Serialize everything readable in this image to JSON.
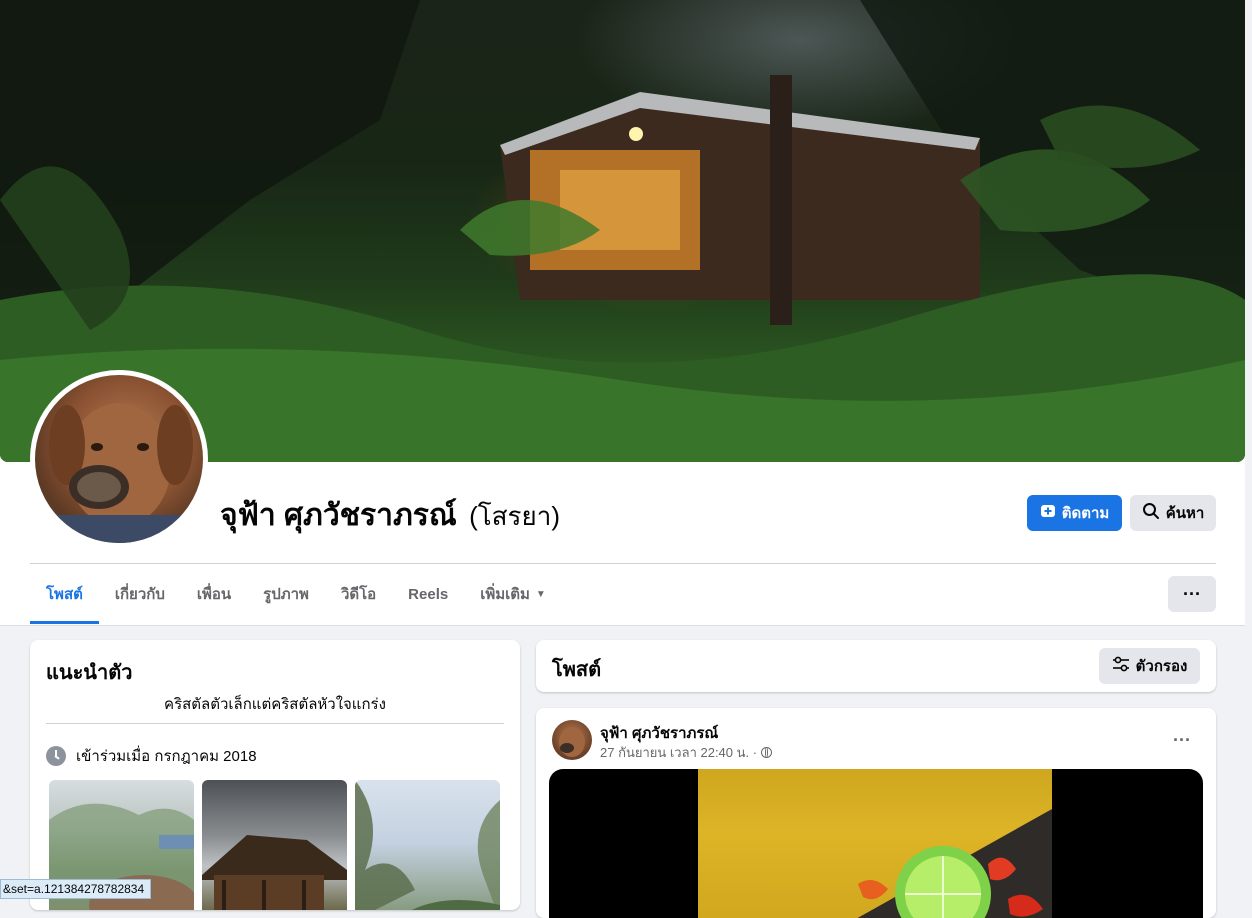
{
  "profile": {
    "name": "จุฟ้า ศุภวัชราภรณ์",
    "alternate_name": "(โสรยา)"
  },
  "actions": {
    "follow_label": "ติดตาม",
    "search_label": "ค้นหา",
    "more_label": "···"
  },
  "tabs": [
    {
      "label": "โพสต์",
      "active": true
    },
    {
      "label": "เกี่ยวกับ",
      "active": false
    },
    {
      "label": "เพื่อน",
      "active": false
    },
    {
      "label": "รูปภาพ",
      "active": false
    },
    {
      "label": "วิดีโอ",
      "active": false
    },
    {
      "label": "Reels",
      "active": false
    },
    {
      "label": "เพิ่มเติม",
      "active": false
    }
  ],
  "intro": {
    "title": "แนะนำตัว",
    "bio": "คริสตัลตัวเล็กแต่คริสตัลหัวใจแกร่ง",
    "joined": "เข้าร่วมเมื่อ กรกฎาคม 2018"
  },
  "posts_section": {
    "title": "โพสต์",
    "filter_label": "ตัวกรอง"
  },
  "post": {
    "author": "จุฟ้า ศุภวัชราภรณ์",
    "timestamp": "27 กันยายน เวลา 22:40 น. ·",
    "more_label": "···"
  },
  "status_url": "&set=a.121384278782834",
  "colors": {
    "accent": "#1b74e4",
    "page_background": "#f0f2f5",
    "button_secondary": "#e4e6eb"
  },
  "icons": {
    "follow": "add-friend-icon",
    "search": "search-icon",
    "filter": "filter-sliders-icon",
    "joined": "clock-icon",
    "privacy": "globe-icon",
    "dropdown": "caret-down-icon"
  }
}
